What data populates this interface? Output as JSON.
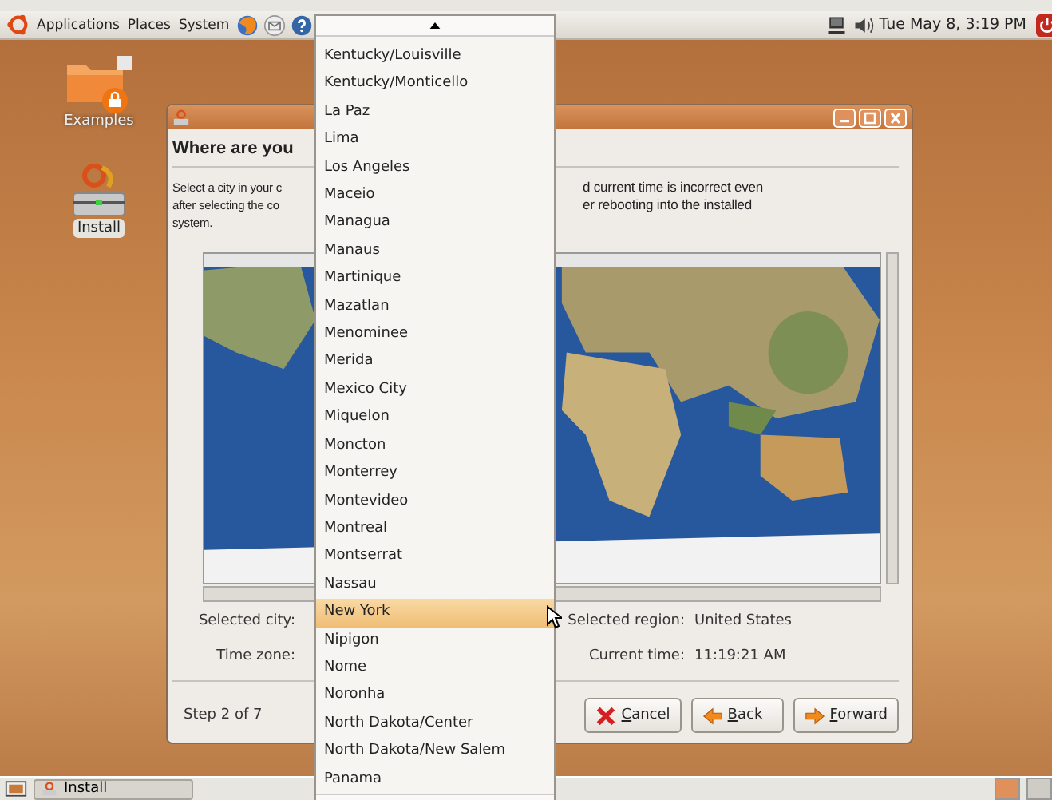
{
  "top_panel": {
    "menus": [
      {
        "label": "Applications"
      },
      {
        "label": "Places"
      },
      {
        "label": "System"
      }
    ],
    "clock": "Tue May 8, 3:19 PM"
  },
  "desktop_icons": [
    {
      "kind": "folder",
      "label": "Examples"
    },
    {
      "kind": "installer",
      "label": "Install"
    }
  ],
  "window": {
    "heading": "Where are you",
    "intro_left": [
      "Select a city in your c",
      "after selecting the co",
      "system."
    ],
    "intro_right": [
      "d current time is incorrect even",
      "er rebooting into the installed"
    ],
    "selected_city_label": "Selected city:",
    "time_zone_label": "Time zone:",
    "selected_region_label": "Selected region:",
    "selected_region": "United States",
    "current_time_label": "Current time:",
    "current_time": "11:19:21 AM",
    "step": "Step 2 of 7",
    "buttons": [
      {
        "kind": "cancel",
        "label": "Cancel"
      },
      {
        "kind": "back",
        "label": "Back"
      },
      {
        "kind": "forward",
        "label": "Forward"
      }
    ]
  },
  "dropdown": {
    "items": [
      {
        "label": "Kentucky/Louisville",
        "selected": false
      },
      {
        "label": "Kentucky/Monticello",
        "selected": false
      },
      {
        "label": "La Paz",
        "selected": false
      },
      {
        "label": "Lima",
        "selected": false
      },
      {
        "label": "Los Angeles",
        "selected": false
      },
      {
        "label": "Maceio",
        "selected": false
      },
      {
        "label": "Managua",
        "selected": false
      },
      {
        "label": "Manaus",
        "selected": false
      },
      {
        "label": "Martinique",
        "selected": false
      },
      {
        "label": "Mazatlan",
        "selected": false
      },
      {
        "label": "Menominee",
        "selected": false
      },
      {
        "label": "Merida",
        "selected": false
      },
      {
        "label": "Mexico City",
        "selected": false
      },
      {
        "label": "Miquelon",
        "selected": false
      },
      {
        "label": "Moncton",
        "selected": false
      },
      {
        "label": "Monterrey",
        "selected": false
      },
      {
        "label": "Montevideo",
        "selected": false
      },
      {
        "label": "Montreal",
        "selected": false
      },
      {
        "label": "Montserrat",
        "selected": false
      },
      {
        "label": "Nassau",
        "selected": false
      },
      {
        "label": "New York",
        "selected": true
      },
      {
        "label": "Nipigon",
        "selected": false
      },
      {
        "label": "Nome",
        "selected": false
      },
      {
        "label": "Noronha",
        "selected": false
      },
      {
        "label": "North Dakota/Center",
        "selected": false
      },
      {
        "label": "North Dakota/New Salem",
        "selected": false
      },
      {
        "label": "Panama",
        "selected": false
      }
    ]
  },
  "taskbar": {
    "tasks": [
      {
        "label": "Install"
      }
    ]
  }
}
